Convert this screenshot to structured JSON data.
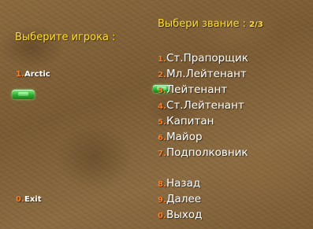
{
  "left_menu": {
    "title": "Выберите игрока :",
    "players": [
      {
        "num": "1.",
        "label": "Arctic"
      }
    ],
    "exit": {
      "num": "0.",
      "label": "Exit"
    }
  },
  "right_menu": {
    "title": "Выбери звание :",
    "page": "2/3",
    "items": [
      {
        "num": "1.",
        "label": "Ст.Прапорщик"
      },
      {
        "num": "2.",
        "label": "Мл.Лейтенант"
      },
      {
        "num": "3.",
        "label": "Лейтенант"
      },
      {
        "num": "4.",
        "label": "Ст.Лейтенант"
      },
      {
        "num": "5.",
        "label": "Капитан"
      },
      {
        "num": "6.",
        "label": "Майор"
      },
      {
        "num": "7.",
        "label": "Подполковник"
      }
    ],
    "nav": [
      {
        "num": "8.",
        "label": "Назад"
      },
      {
        "num": "9.",
        "label": "Далее"
      },
      {
        "num": "0.",
        "label": "Выход"
      }
    ]
  }
}
